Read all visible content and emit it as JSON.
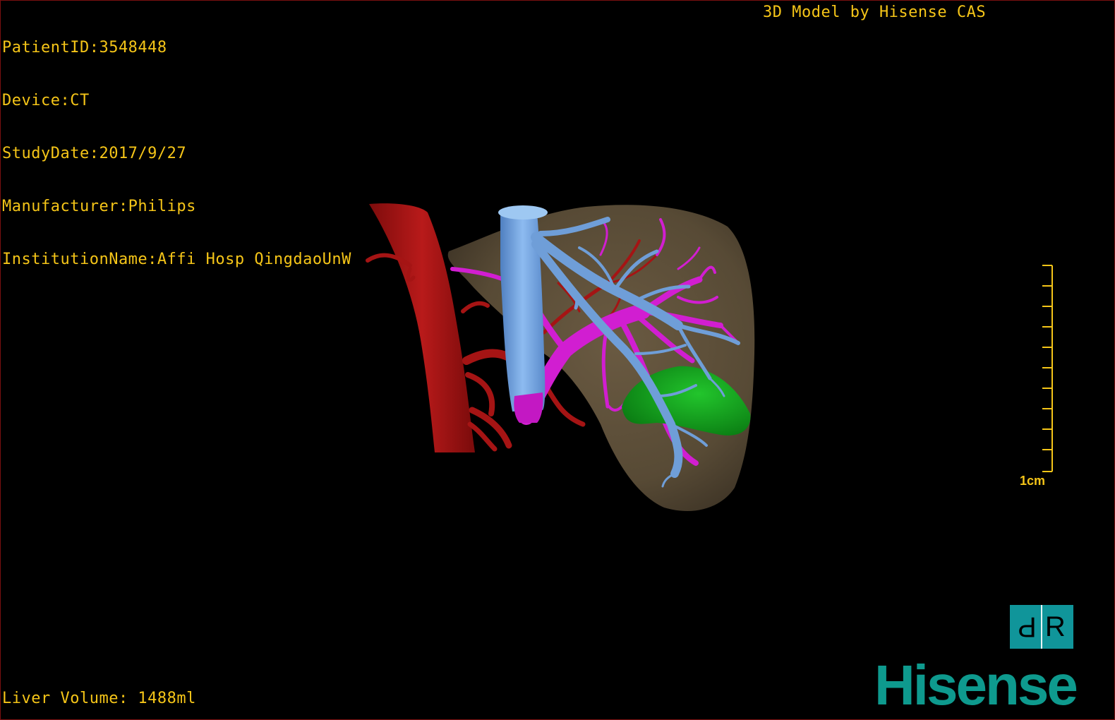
{
  "patient_info": {
    "patient_id": "PatientID:3548448",
    "device": "Device:CT",
    "study_date": "StudyDate:2017/9/27",
    "manufacturer": "Manufacturer:Philips",
    "institution": "InstitutionName:Affi Hosp QingdaoUnW"
  },
  "watermark": "3D Model by Hisense CAS",
  "liver_volume": "Liver Volume: 1488ml",
  "scale_bar": {
    "label": "1cm"
  },
  "orientation_cube": {
    "left": "P",
    "right": "R"
  },
  "brand": "Hisense",
  "colors": {
    "overlay_text": "#f5c518",
    "liver": "#5e4f39",
    "artery": "#a51414",
    "hepatic_vein": "#6f9ed8",
    "portal_vein": "#d11ed1",
    "gallbladder": "#0ea21a",
    "brand": "#0e9a8e"
  }
}
